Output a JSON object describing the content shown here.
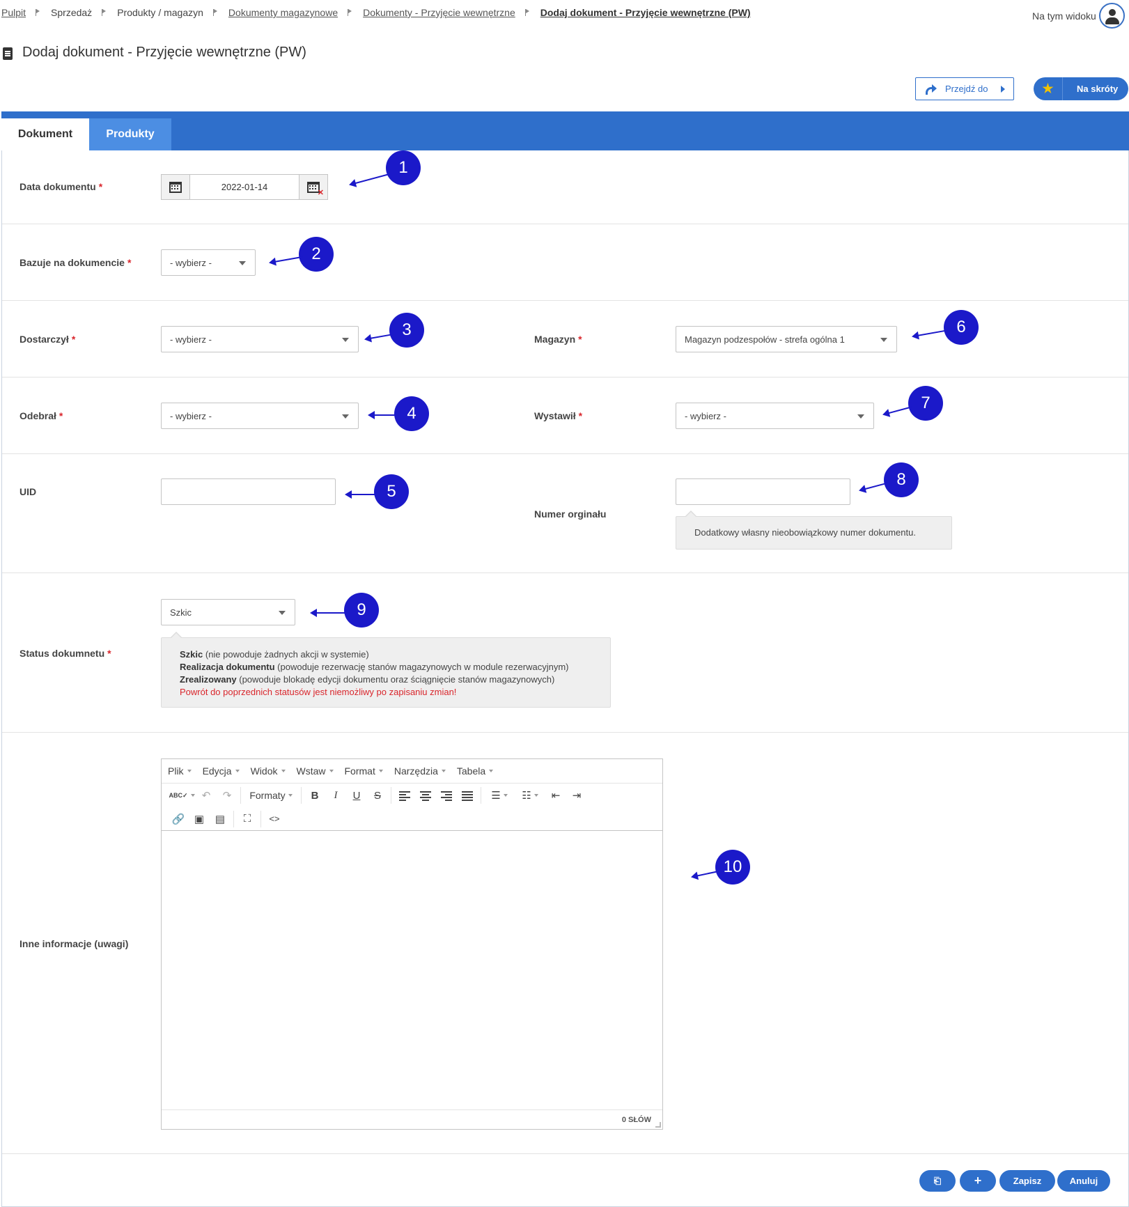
{
  "breadcrumb": {
    "items": [
      {
        "label": "Pulpit"
      },
      {
        "label": "Sprzedaż"
      },
      {
        "label": "Produkty / magazyn"
      },
      {
        "label": "Dokumenty magazynowe"
      },
      {
        "label": "Dokumenty - Przyjęcie wewnętrzne"
      },
      {
        "label": "Dodaj dokument - Przyjęcie wewnętrzne (PW)"
      }
    ]
  },
  "header": {
    "view_label": "Na tym widoku",
    "page_title": "Dodaj dokument - Przyjęcie wewnętrzne (PW)",
    "goto_label": "Przejdź do",
    "shortcuts_label": "Na skróty"
  },
  "tabs": [
    {
      "label": "Dokument",
      "active": true
    },
    {
      "label": "Produkty",
      "active": false
    }
  ],
  "form": {
    "date": {
      "label": "Data dokumentu",
      "value": "2022-01-14"
    },
    "based_on": {
      "label": "Bazuje na dokumencie",
      "value": "- wybierz -"
    },
    "delivered": {
      "label": "Dostarczył",
      "value": "- wybierz -"
    },
    "warehouse": {
      "label": "Magazyn",
      "value": "Magazyn podzespołów - strefa ogólna 1"
    },
    "received": {
      "label": "Odebrał",
      "value": "- wybierz -"
    },
    "issued": {
      "label": "Wystawił",
      "value": "- wybierz -"
    },
    "uid": {
      "label": "UID",
      "value": ""
    },
    "original_number": {
      "label": "Numer orginału",
      "value": "",
      "hint": "Dodatkowy własny nieobowiązkowy numer dokumentu."
    },
    "status": {
      "label": "Status dokumnetu",
      "value": "Szkic",
      "hint_lines": [
        {
          "bold": "Szkic",
          "text": " (nie powoduje żadnych akcji w systemie)"
        },
        {
          "bold": "Realizacja dokumentu",
          "text": " (powoduje rezerwację stanów magazynowych w module rezerwacyjnym)"
        },
        {
          "bold": "Zrealizowany",
          "text": " (powoduje blokadę edycji dokumentu oraz ściągnięcie stanów magazynowych)"
        }
      ],
      "hint_warning": "Powrót do poprzednich statusów jest niemożliwy po zapisaniu zmian!"
    },
    "notes": {
      "label": "Inne informacje (uwagi)",
      "menu": [
        "Plik",
        "Edycja",
        "Widok",
        "Wstaw",
        "Format",
        "Narzędzia",
        "Tabela"
      ],
      "formats_label": "Formaty",
      "word_count": "0 SŁÓW"
    }
  },
  "footer": {
    "save_label": "Zapisz",
    "cancel_label": "Anuluj"
  },
  "annotations": [
    "1",
    "2",
    "3",
    "4",
    "5",
    "6",
    "7",
    "8",
    "9",
    "10"
  ],
  "colors": {
    "accent": "#2f6fcb",
    "tab_inactive": "#4c8ee3",
    "required": "#d9262c",
    "marker": "#1b19c9"
  }
}
